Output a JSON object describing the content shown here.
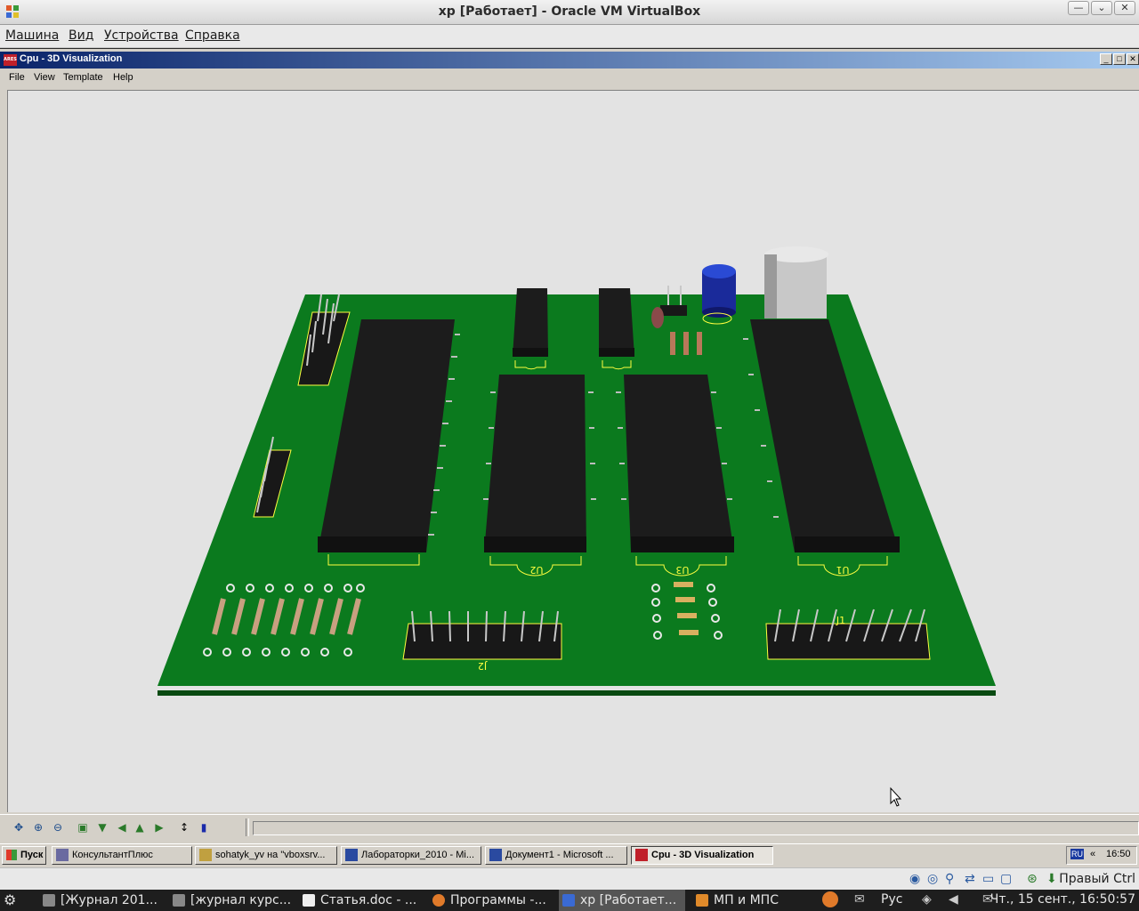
{
  "host_window": {
    "title": "xp [Работает] - Oracle VM VirtualBox",
    "menu": [
      "Машина",
      "Вид",
      "Устройства",
      "Справка"
    ],
    "controls": [
      "minimize",
      "restore",
      "close"
    ]
  },
  "app_window": {
    "title": "Cpu - 3D Visualization",
    "icon": "ares-icon",
    "menu": [
      "File",
      "View",
      "Template",
      "Help"
    ]
  },
  "board": {
    "background_color": "#e3e3e3",
    "pcb_color": "#0b7a1e",
    "silkscreen_color": "#ffff40",
    "labels": [
      "U1",
      "U2",
      "U3",
      "J1",
      "J2"
    ]
  },
  "toolbar": {
    "buttons": [
      "pan-icon",
      "zoom-in-icon",
      "zoom-out-icon",
      "view-top-icon",
      "view-front-icon",
      "rotate-left-icon",
      "view-up-icon",
      "rotate-right-icon",
      "height-icon",
      "monitor-icon"
    ]
  },
  "xp_taskbar": {
    "start_label": "Пуск",
    "tasks": [
      {
        "label": "КонсультантПлюс",
        "active": false
      },
      {
        "label": "sohatyk_yv на \"vboxsrv...",
        "active": false
      },
      {
        "label": "Лабораторки_2010 - Mi...",
        "active": false
      },
      {
        "label": "Документ1 - Microsoft ...",
        "active": false
      },
      {
        "label": "Cpu - 3D Visualization",
        "active": true
      }
    ],
    "lang": "RU",
    "tray_arrow": "«",
    "time": "16:50"
  },
  "host_indicators": {
    "host_key_label": "Правый Ctrl"
  },
  "host_taskbar": {
    "items": [
      {
        "label": "[Журнал 201...",
        "active": false
      },
      {
        "label": "[журнал курс...",
        "active": false
      },
      {
        "label": "Статья.doc - ...",
        "active": false
      },
      {
        "label": "Программы -...",
        "active": false
      },
      {
        "label": "xp [Работает...",
        "active": true
      },
      {
        "label": "МП и МПС",
        "active": false
      }
    ],
    "lang": "Рус",
    "clock": "Чт., 15 сент., 16:50:57"
  }
}
